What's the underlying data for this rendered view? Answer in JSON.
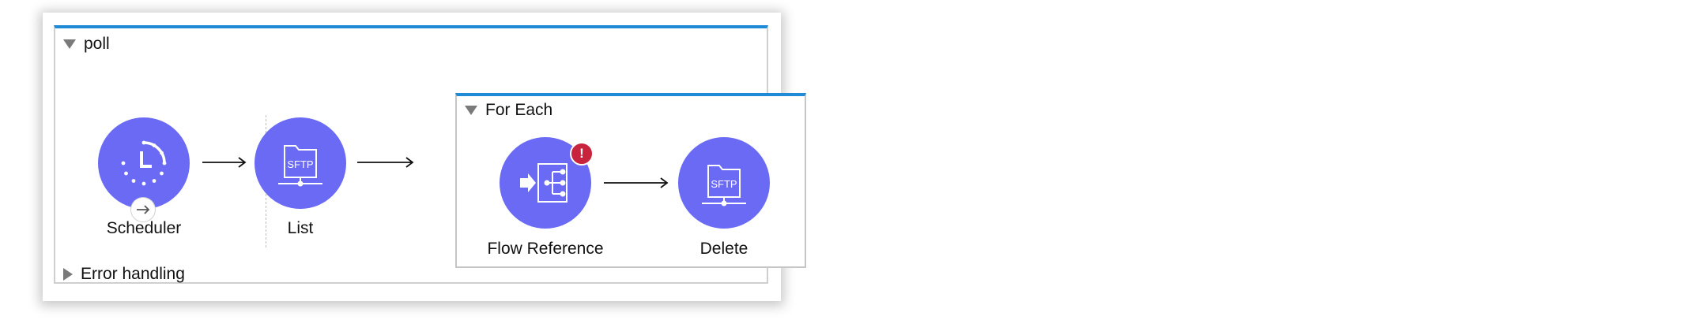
{
  "flow": {
    "name": "poll",
    "error_handling_label": "Error handling"
  },
  "components": {
    "scheduler": {
      "label": "Scheduler",
      "icon": "clock-icon"
    },
    "list": {
      "label": "List",
      "icon": "sftp-folder-icon",
      "icon_text": "SFTP"
    },
    "flow_reference": {
      "label": "Flow Reference",
      "icon": "flow-reference-icon",
      "error_badge": "!"
    },
    "delete": {
      "label": "Delete",
      "icon": "sftp-folder-icon",
      "icon_text": "SFTP"
    }
  },
  "scope": {
    "label": "For Each"
  },
  "colors": {
    "node": "#6a6af4",
    "accent": "#1f8ad6",
    "error": "#c8243d"
  }
}
